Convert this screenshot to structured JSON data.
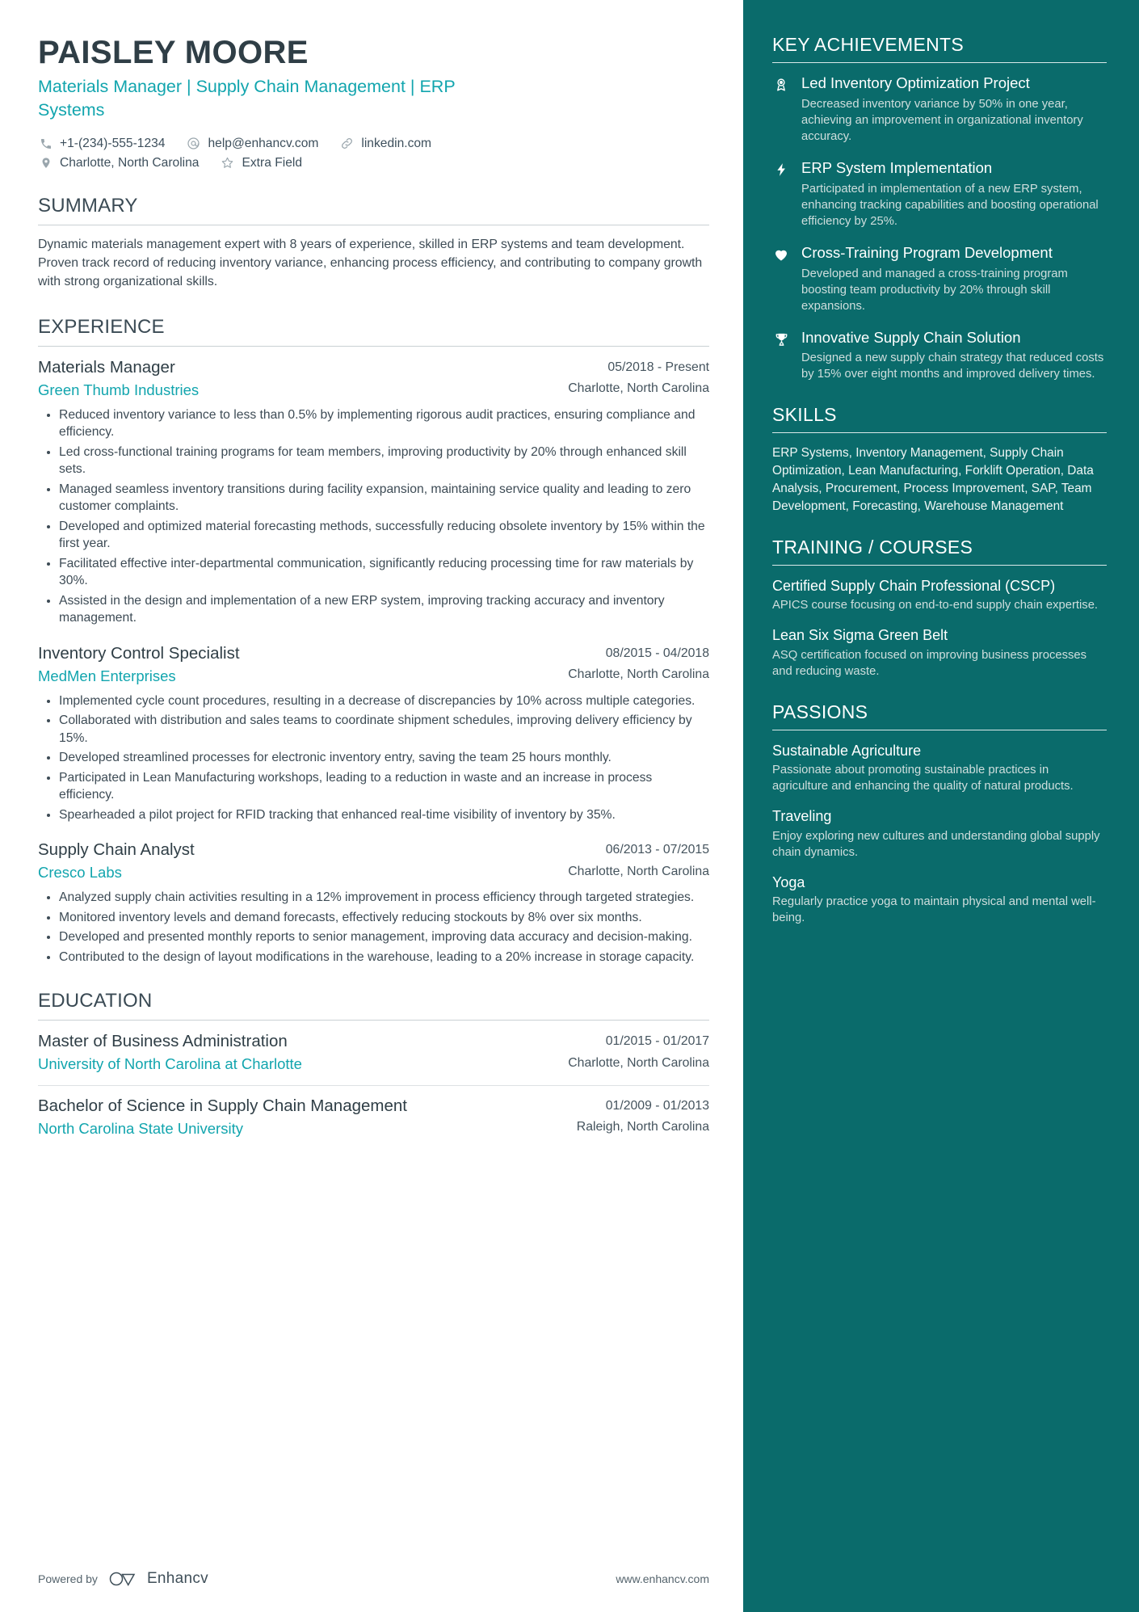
{
  "colors": {
    "accent_teal": "#12a5ae",
    "sidebar_bg": "#0a6b6b",
    "heading_dark": "#2f3e46",
    "body_text": "#3d4b55"
  },
  "header": {
    "name": "PAISLEY MOORE",
    "headline": "Materials Manager | Supply Chain Management | ERP Systems",
    "contacts": [
      {
        "icon": "phone-icon",
        "text": "+1-(234)-555-1234"
      },
      {
        "icon": "email-icon",
        "text": "help@enhancv.com"
      },
      {
        "icon": "link-icon",
        "text": "linkedin.com"
      },
      {
        "icon": "location-icon",
        "text": "Charlotte, North Carolina"
      },
      {
        "icon": "star-icon",
        "text": "Extra Field"
      }
    ]
  },
  "summary": {
    "title": "SUMMARY",
    "text": "Dynamic materials management expert with 8 years of experience, skilled in ERP systems and team development. Proven track record of reducing inventory variance, enhancing process efficiency, and contributing to company growth with strong organizational skills."
  },
  "experience": {
    "title": "EXPERIENCE",
    "entries": [
      {
        "role": "Materials Manager",
        "company": "Green Thumb Industries",
        "dates": "05/2018 - Present",
        "location": "Charlotte, North Carolina",
        "bullets": [
          "Reduced inventory variance to less than 0.5% by implementing rigorous audit practices, ensuring compliance and efficiency.",
          "Led cross-functional training programs for team members, improving productivity by 20% through enhanced skill sets.",
          "Managed seamless inventory transitions during facility expansion, maintaining service quality and leading to zero customer complaints.",
          "Developed and optimized material forecasting methods, successfully reducing obsolete inventory by 15% within the first year.",
          "Facilitated effective inter-departmental communication, significantly reducing processing time for raw materials by 30%.",
          " Assisted in the design and implementation of a new ERP system, improving tracking accuracy and inventory management."
        ]
      },
      {
        "role": "Inventory Control Specialist",
        "company": "MedMen Enterprises",
        "dates": "08/2015 - 04/2018",
        "location": "Charlotte, North Carolina",
        "bullets": [
          "Implemented cycle count procedures, resulting in a decrease of discrepancies by 10% across multiple categories.",
          "Collaborated with distribution and sales teams to coordinate shipment schedules, improving delivery efficiency by 15%.",
          "Developed streamlined processes for electronic inventory entry, saving the team 25 hours monthly.",
          "Participated in Lean Manufacturing workshops, leading to a reduction in waste and an increase in process efficiency.",
          "Spearheaded a pilot project for RFID tracking that enhanced real-time visibility of inventory by 35%."
        ]
      },
      {
        "role": "Supply Chain Analyst",
        "company": "Cresco Labs",
        "dates": "06/2013 - 07/2015",
        "location": "Charlotte, North Carolina",
        "bullets": [
          "Analyzed supply chain activities resulting in a 12% improvement in process efficiency through targeted strategies.",
          "Monitored inventory levels and demand forecasts, effectively reducing stockouts by 8% over six months.",
          "Developed and presented monthly reports to senior management, improving data accuracy and decision-making.",
          "Contributed to the design of layout modifications in the warehouse, leading to a 20% increase in storage capacity."
        ]
      }
    ]
  },
  "education": {
    "title": "EDUCATION",
    "entries": [
      {
        "degree": "Master of Business Administration",
        "school": "University of North Carolina at Charlotte",
        "dates": "01/2015 - 01/2017",
        "location": "Charlotte, North Carolina"
      },
      {
        "degree": "Bachelor of Science in Supply Chain Management",
        "school": "North Carolina State University",
        "dates": "01/2009 - 01/2013",
        "location": "Raleigh, North Carolina"
      }
    ]
  },
  "footer": {
    "powered_by": "Powered by",
    "brand": "Enhancv",
    "website": "www.enhancv.com"
  },
  "sidebar": {
    "achievements": {
      "title": "KEY ACHIEVEMENTS",
      "items": [
        {
          "icon": "award-ribbon-icon",
          "title": "Led Inventory Optimization Project",
          "description": "Decreased inventory variance by 50% in one year, achieving an improvement in organizational inventory accuracy."
        },
        {
          "icon": "lightning-bolt-icon",
          "title": "ERP System Implementation",
          "description": "Participated in implementation of a new ERP system, enhancing tracking capabilities and boosting operational efficiency by 25%."
        },
        {
          "icon": "heart-icon",
          "title": "Cross-Training Program Development",
          "description": "Developed and managed a cross-training program boosting team productivity by 20% through skill expansions."
        },
        {
          "icon": "trophy-icon",
          "title": "Innovative Supply Chain Solution",
          "description": "Designed a new supply chain strategy that reduced costs by 15% over eight months and improved delivery times."
        }
      ]
    },
    "skills": {
      "title": "SKILLS",
      "text": "ERP Systems, Inventory Management, Supply Chain Optimization, Lean Manufacturing, Forklift Operation, Data Analysis, Procurement, Process Improvement, SAP, Team Development, Forecasting, Warehouse Management"
    },
    "training": {
      "title": "TRAINING / COURSES",
      "items": [
        {
          "title": "Certified Supply Chain Professional (CSCP)",
          "description": "APICS course focusing on end-to-end supply chain expertise."
        },
        {
          "title": "Lean Six Sigma Green Belt",
          "description": "ASQ certification focused on improving business processes and reducing waste."
        }
      ]
    },
    "passions": {
      "title": "PASSIONS",
      "items": [
        {
          "title": "Sustainable Agriculture",
          "description": "Passionate about promoting sustainable practices in agriculture and enhancing the quality of natural products."
        },
        {
          "title": "Traveling",
          "description": "Enjoy exploring new cultures and understanding global supply chain dynamics."
        },
        {
          "title": "Yoga",
          "description": "Regularly practice yoga to maintain physical and mental well-being."
        }
      ]
    }
  }
}
